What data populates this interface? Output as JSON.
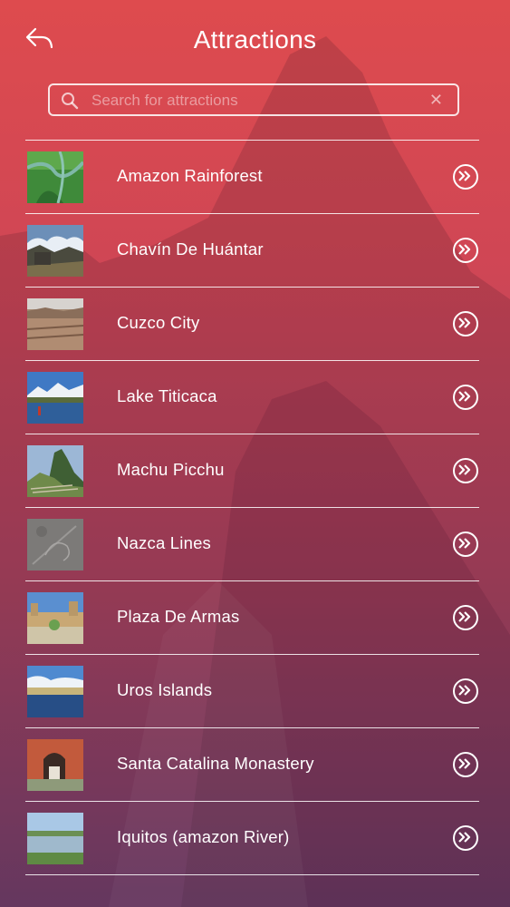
{
  "header": {
    "title": "Attractions",
    "back_icon": "back-arrow-icon"
  },
  "search": {
    "placeholder": "Search for attractions",
    "value": "",
    "search_icon": "magnifier-icon",
    "clear_label": "✕"
  },
  "attractions": [
    {
      "label": "Amazon Rainforest",
      "thumb": "amazon-rainforest-photo"
    },
    {
      "label": "Chavín De Huántar",
      "thumb": "chavin-de-huantar-photo"
    },
    {
      "label": "Cuzco City",
      "thumb": "cuzco-city-photo"
    },
    {
      "label": "Lake Titicaca",
      "thumb": "lake-titicaca-photo"
    },
    {
      "label": "Machu Picchu",
      "thumb": "machu-picchu-photo"
    },
    {
      "label": "Nazca Lines",
      "thumb": "nazca-lines-photo"
    },
    {
      "label": "Plaza De Armas",
      "thumb": "plaza-de-armas-photo"
    },
    {
      "label": "Uros Islands",
      "thumb": "uros-islands-photo"
    },
    {
      "label": "Santa Catalina Monastery",
      "thumb": "santa-catalina-monastery-photo"
    },
    {
      "label": "Iquitos (amazon River)",
      "thumb": "iquitos-amazon-river-photo"
    }
  ],
  "colors": {
    "gradient_top": "#de4b4e",
    "gradient_bottom": "#6e3f6c",
    "foreground": "#ffffff"
  }
}
